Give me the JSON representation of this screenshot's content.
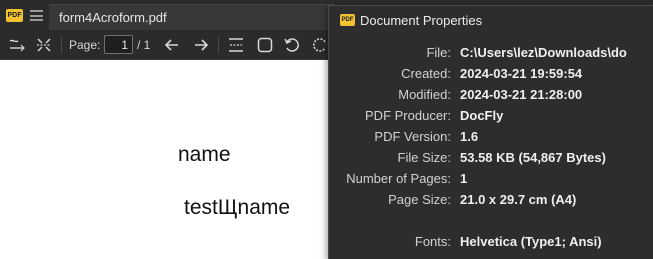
{
  "window": {
    "tab_title": "form4Acroform.pdf",
    "logo_text": "PDF"
  },
  "toolbar": {
    "page_label": "Page:",
    "current_page": "1",
    "page_total": "/ 1",
    "icons": [
      "text-select-icon",
      "zoom-fit-icon",
      "back-arrow-icon",
      "forward-arrow-icon",
      "fit-width-icon",
      "square-shape-icon",
      "rotate-left-icon",
      "rotate-right-icon"
    ]
  },
  "document": {
    "line1": "name",
    "line2": "testЩname"
  },
  "dialog": {
    "title": "Document Properties",
    "logo_text": "PDF",
    "properties": [
      {
        "label": "File:",
        "value": "C:\\Users\\lez\\Downloads\\do"
      },
      {
        "label": "Created:",
        "value": "2024-03-21 19:59:54"
      },
      {
        "label": "Modified:",
        "value": "2024-03-21 21:28:00"
      },
      {
        "label": "PDF Producer:",
        "value": "DocFly"
      },
      {
        "label": "PDF Version:",
        "value": "1.6"
      },
      {
        "label": "File Size:",
        "value": "53.58 KB (54,867 Bytes)"
      },
      {
        "label": "Number of Pages:",
        "value": "1"
      },
      {
        "label": "Page Size:",
        "value": "21.0 x 29.7 cm (A4)"
      },
      {
        "label": "Fonts:",
        "value": "Helvetica (Type1; Ansi)"
      }
    ]
  },
  "colors": {
    "chrome_bg": "#2b2b2b",
    "dialog_bg": "#2d2d2d",
    "logo_yellow": "#f2c230",
    "document_bg": "#ffffff"
  }
}
